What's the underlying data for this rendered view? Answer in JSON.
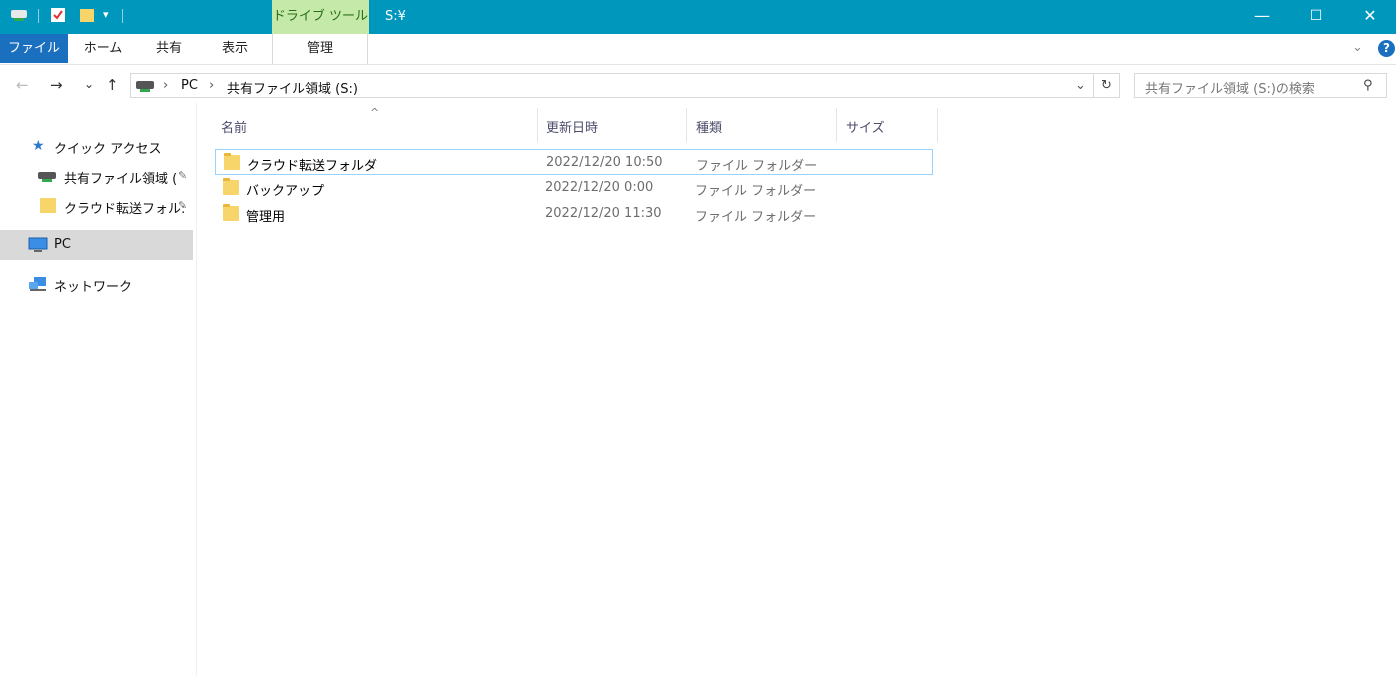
{
  "titlebar": {
    "contextual_tab_label": "ドライブ ツール",
    "window_title": "S:¥",
    "minimize_glyph": "—",
    "maximize_glyph": "☐",
    "close_glyph": "✕"
  },
  "ribbon": {
    "tabs": [
      {
        "label": "ファイル"
      },
      {
        "label": "ホーム"
      },
      {
        "label": "共有"
      },
      {
        "label": "表示"
      }
    ],
    "manage_label": "管理",
    "expand_glyph": "⌄",
    "help_glyph": "?"
  },
  "address": {
    "back_glyph": "←",
    "forward_glyph": "→",
    "recent_glyph": "⌄",
    "up_glyph": "↑",
    "sep1": "›",
    "crumb_pc": "PC",
    "sep2": "›",
    "crumb_drive": "共有ファイル領域 (S:)",
    "dropdown_glyph": "⌄",
    "refresh_glyph": "↻",
    "search_placeholder": "共有ファイル領域 (S:)の検索",
    "search_glyph": "⚲"
  },
  "navpane": {
    "quick_access": "クイック アクセス",
    "pinned": [
      {
        "label": "共有ファイル領域 (",
        "icon": "drive-icon"
      },
      {
        "label": "クラウド転送フォル:",
        "icon": "folder-icon"
      }
    ],
    "pin_glyph": "📌",
    "pc": "PC",
    "network": "ネットワーク"
  },
  "columns": {
    "sort_glyph": "^",
    "name": "名前",
    "modified": "更新日時",
    "type": "種類",
    "size": "サイズ"
  },
  "files": [
    {
      "name": "クラウド転送フォルダ",
      "modified": "2022/12/20 10:50",
      "type": "ファイル フォルダー",
      "size": ""
    },
    {
      "name": "バックアップ",
      "modified": "2022/12/20 0:00",
      "type": "ファイル フォルダー",
      "size": ""
    },
    {
      "name": "管理用",
      "modified": "2022/12/20 11:30",
      "type": "ファイル フォルダー",
      "size": ""
    }
  ],
  "colors": {
    "titlebar": "#0097bd",
    "file_tab": "#1a6fbf",
    "contextual_tab": "#c5e9a8",
    "selection_border": "#99d1ff"
  }
}
